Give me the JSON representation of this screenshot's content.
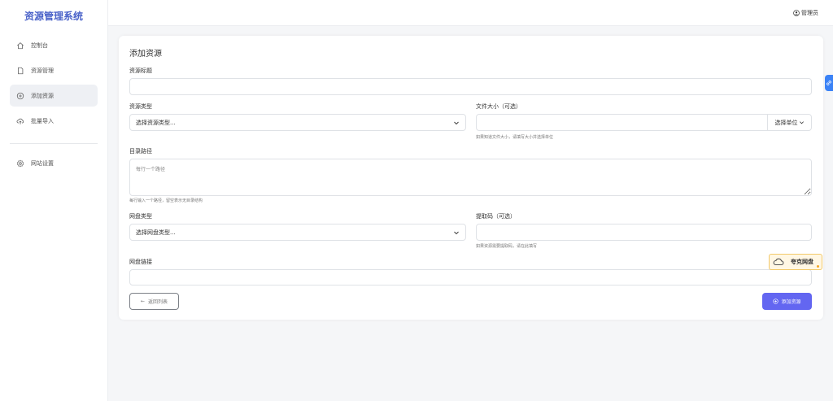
{
  "app": {
    "title": "资源管理系统"
  },
  "sidebar": {
    "items": [
      {
        "label": "控制台",
        "icon": "home-icon"
      },
      {
        "label": "资源管理",
        "icon": "file-icon"
      },
      {
        "label": "添加资源",
        "icon": "plus-circle-icon",
        "active": true
      },
      {
        "label": "批量导入",
        "icon": "cloud-upload-icon"
      }
    ],
    "settings": {
      "label": "网站设置",
      "icon": "gear-icon"
    }
  },
  "header": {
    "user_label": "管理员",
    "user_icon": "user-circle-icon"
  },
  "form": {
    "title": "添加资源",
    "resource_title": {
      "label": "资源标题",
      "value": ""
    },
    "resource_type": {
      "label": "资源类型",
      "selected": "选择资源类型..."
    },
    "file_size": {
      "label": "文件大小（可选）",
      "value": "",
      "unit_label": "选择单位",
      "hint": "如果知道文件大小，请填写大小并选择单位"
    },
    "dir_path": {
      "label": "目录路径",
      "placeholder": "每行一个路径",
      "hint": "每行输入一个路径，留空表示无目录结构"
    },
    "pan_type": {
      "label": "网盘类型",
      "selected": "选择网盘类型..."
    },
    "extract_code": {
      "label": "提取码（可选）",
      "value": "",
      "hint": "如果资源需要提取码，请在此填写"
    },
    "pan_link": {
      "label": "网盘链接",
      "value": ""
    },
    "back_button": "返回列表",
    "submit_button": "添加资源"
  },
  "overlay": {
    "badge_label": "夸克网盘",
    "badge_color": "#f2c96a"
  },
  "colors": {
    "accent": "#6366f1",
    "brand": "#4b63c9"
  }
}
